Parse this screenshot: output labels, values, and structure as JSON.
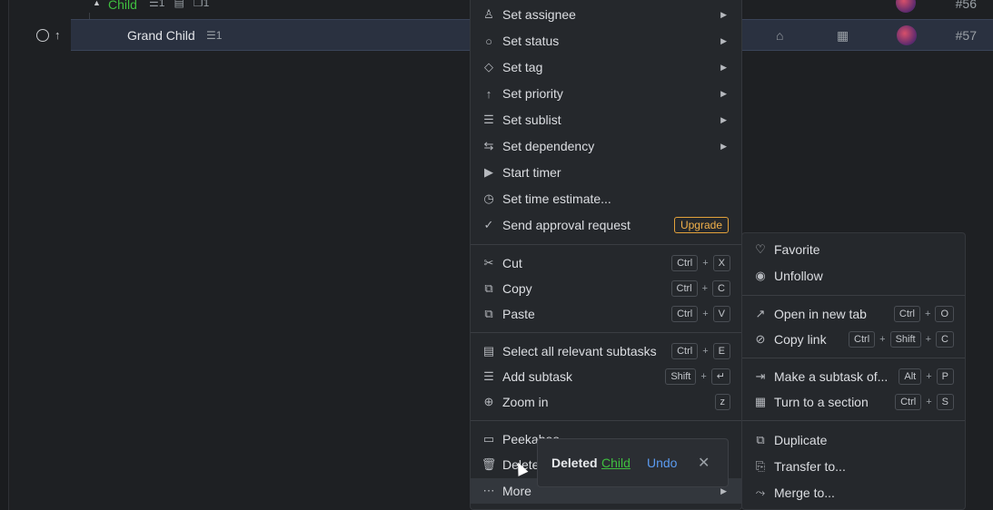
{
  "task_list": {
    "child_row": {
      "label": "Child",
      "subtasks": "1",
      "attachments": "1",
      "number": "#56"
    },
    "grandchild_row": {
      "label": "Grand Child",
      "subtasks": "1",
      "number": "#57"
    }
  },
  "context_menu": {
    "items": [
      {
        "label": "Set assignee",
        "icon": "user-icon",
        "has_submenu": true
      },
      {
        "label": "Set status",
        "icon": "circle-icon",
        "has_submenu": true
      },
      {
        "label": "Set tag",
        "icon": "tag-icon",
        "has_submenu": true
      },
      {
        "label": "Set priority",
        "icon": "arrow-up-icon",
        "has_submenu": true
      },
      {
        "label": "Set sublist",
        "icon": "list-icon",
        "has_submenu": true
      },
      {
        "label": "Set dependency",
        "icon": "swap-icon",
        "has_submenu": true
      },
      {
        "label": "Start timer",
        "icon": "play-icon"
      },
      {
        "label": "Set time estimate...",
        "icon": "stopwatch-icon"
      },
      {
        "label": "Send approval request",
        "icon": "check-circle-icon",
        "badge": "Upgrade"
      },
      {
        "label": "Cut",
        "icon": "scissors-icon",
        "keys": [
          "Ctrl",
          "X"
        ]
      },
      {
        "label": "Copy",
        "icon": "copy-icon",
        "keys": [
          "Ctrl",
          "C"
        ]
      },
      {
        "label": "Paste",
        "icon": "paste-icon",
        "keys": [
          "Ctrl",
          "V"
        ]
      },
      {
        "label": "Select all relevant subtasks",
        "icon": "select-icon",
        "keys": [
          "Ctrl",
          "E"
        ]
      },
      {
        "label": "Add subtask",
        "icon": "add-subtask-icon",
        "keys": [
          "Shift",
          "↵"
        ]
      },
      {
        "label": "Zoom in",
        "icon": "zoom-icon",
        "keys": [
          "z"
        ]
      },
      {
        "label": "Peekaboo",
        "icon": "archive-icon"
      },
      {
        "label": "Delete",
        "icon": "trash-icon"
      },
      {
        "label": "More",
        "icon": "more-icon",
        "has_submenu": true
      }
    ]
  },
  "more_submenu": {
    "items": [
      {
        "label": "Favorite",
        "icon": "heart-icon"
      },
      {
        "label": "Unfollow",
        "icon": "eye-off-icon"
      },
      {
        "label": "Open in new tab",
        "icon": "external-link-icon",
        "keys": [
          "Ctrl",
          "O"
        ]
      },
      {
        "label": "Copy link",
        "icon": "link-icon",
        "keys": [
          "Ctrl",
          "Shift",
          "C"
        ]
      },
      {
        "label": "Make a subtask of...",
        "icon": "indent-icon",
        "keys": [
          "Alt",
          "P"
        ]
      },
      {
        "label": "Turn to a section",
        "icon": "section-icon",
        "keys": [
          "Ctrl",
          "S"
        ]
      },
      {
        "label": "Duplicate",
        "icon": "duplicate-icon"
      },
      {
        "label": "Transfer to...",
        "icon": "transfer-icon"
      },
      {
        "label": "Merge to...",
        "icon": "merge-icon"
      }
    ]
  },
  "toast": {
    "text": "Deleted",
    "item": "Child",
    "undo": "Undo",
    "close": "✕"
  },
  "colors": {
    "accent_green": "#3fbf3f",
    "link_blue": "#5b9bf0",
    "upgrade": "#f0b04a",
    "selected_row": "#2a3140"
  }
}
